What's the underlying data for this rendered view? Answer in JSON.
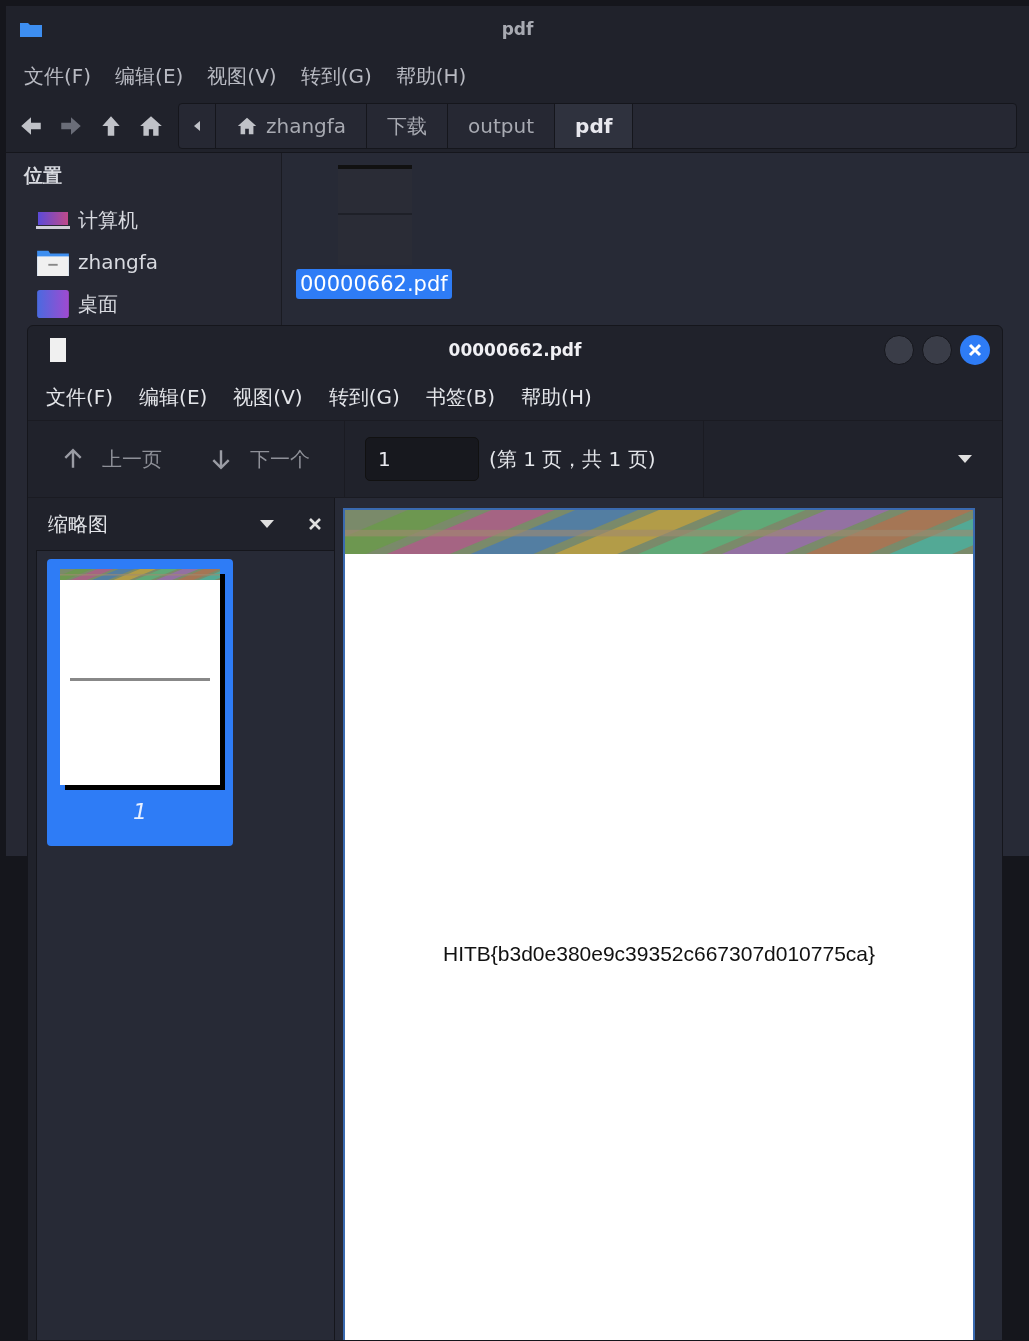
{
  "file_manager": {
    "title": "pdf",
    "menu": [
      "文件(F)",
      "编辑(E)",
      "视图(V)",
      "转到(G)",
      "帮助(H)"
    ],
    "path": [
      {
        "label": "zhangfa",
        "kind": "home",
        "selected": false
      },
      {
        "label": "下载",
        "kind": "folder",
        "selected": false
      },
      {
        "label": "output",
        "kind": "folder",
        "selected": false
      },
      {
        "label": "pdf",
        "kind": "folder",
        "selected": true
      }
    ],
    "sidebar": {
      "heading": "位置",
      "items": [
        {
          "label": "计算机",
          "kind": "computer"
        },
        {
          "label": "zhangfa",
          "kind": "home"
        },
        {
          "label": "桌面",
          "kind": "desktop"
        }
      ]
    },
    "files": [
      {
        "name": "00000662.pdf",
        "selected": true
      }
    ]
  },
  "viewer": {
    "title": "00000662.pdf",
    "menu": [
      "文件(F)",
      "编辑(E)",
      "视图(V)",
      "转到(G)",
      "书签(B)",
      "帮助(H)"
    ],
    "toolbar": {
      "prev": "上一页",
      "next": "下一个",
      "page_value": "1",
      "page_info": "(第 1 页，共 1 页)"
    },
    "sidebar": {
      "title": "缩略图",
      "thumbnails": [
        {
          "label": "1",
          "selected": true
        }
      ]
    },
    "page": {
      "text": "HITB{b3d0e380e9c39352c667307d010775ca}"
    }
  }
}
